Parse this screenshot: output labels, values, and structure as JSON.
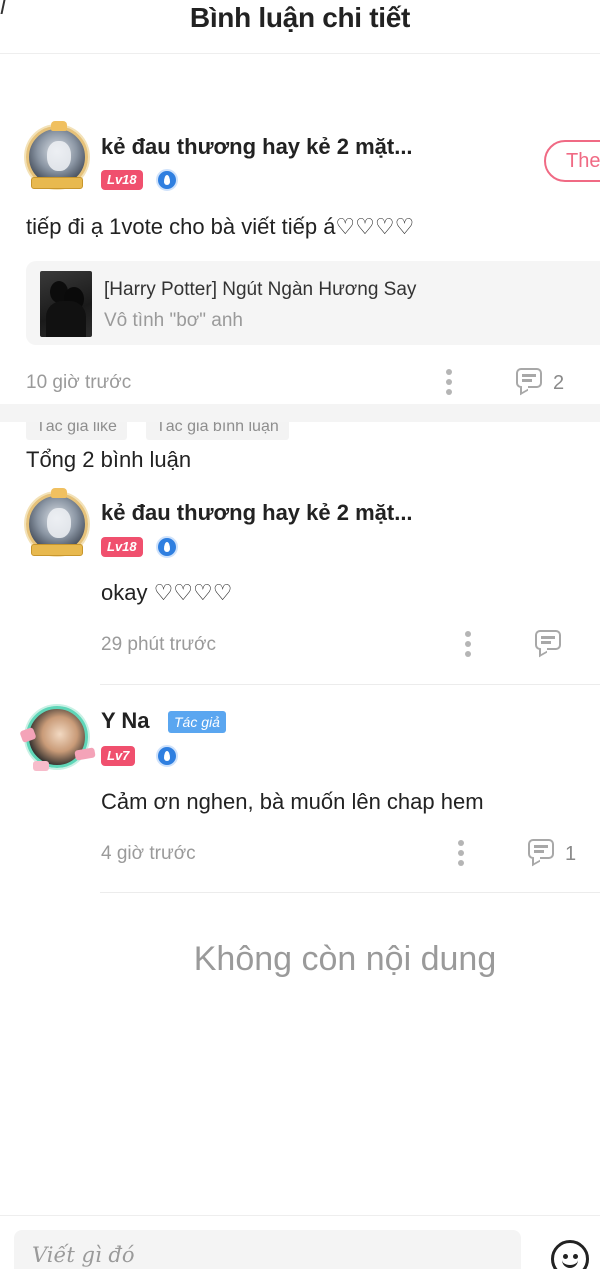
{
  "header": {
    "title": "Bình luận chi tiết"
  },
  "main_comment": {
    "username": "kẻ đau thương hay kẻ 2 mặt...",
    "level": "Lv18",
    "follow_label": "The",
    "text": "tiếp đi ạ 1vote cho bà viết tiếp á♡♡♡♡",
    "story": {
      "title": "[Harry Potter] Ngút Ngàn Hương Say",
      "chapter": "Vô tình \"bơ\" anh"
    },
    "time": "10 giờ trước",
    "reply_count": "2",
    "tags": [
      "Tác giả like",
      "Tác giả bình luận"
    ]
  },
  "replies_section": {
    "total_label": "Tổng 2 bình luận",
    "replies": [
      {
        "username": "kẻ đau thương hay kẻ 2 mặt...",
        "level": "Lv18",
        "text": "okay ♡♡♡♡",
        "time": "29 phút trước",
        "reply_count": ""
      },
      {
        "username": "Y Na",
        "author_tag": "Tác giả",
        "level": "Lv7",
        "text": "Cảm ơn nghen, bà muốn lên chap hem",
        "time": "4 giờ trước",
        "reply_count": "1"
      }
    ],
    "end_text": "Không còn nội dung"
  },
  "input_bar": {
    "placeholder": "Viết gì đó"
  },
  "colors": {
    "level_badge": "#f0506e",
    "author_tag": "#5aa6f0",
    "follow_border": "#f06a84",
    "muted_text": "#9a9a9a"
  }
}
